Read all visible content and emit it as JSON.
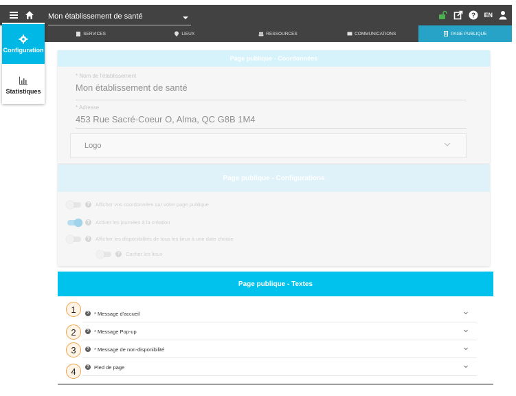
{
  "topbar": {
    "establishment": "Mon établissement de santé",
    "lang": "EN"
  },
  "tabs": [
    {
      "label": "SERVICES",
      "icon": "building-icon"
    },
    {
      "label": "LIEUX",
      "icon": "location-pin-icon"
    },
    {
      "label": "RESSOURCES",
      "icon": "users-icon"
    },
    {
      "label": "COMMUNICATIONS",
      "icon": "envelope-icon"
    },
    {
      "label": "PAGE PUBLIQUE",
      "icon": "document-icon",
      "active": true
    }
  ],
  "sidebar": {
    "items": [
      {
        "label": "Configuration",
        "icon": "gear-icon",
        "active": true
      },
      {
        "label": "Statistiques",
        "icon": "bar-chart-icon"
      }
    ]
  },
  "coords_panel": {
    "title": "Page publique - Coordonnées",
    "name_label": "* Nom de l'établissement",
    "name_value": "Mon établissement de santé",
    "address_label": "* Adresse",
    "address_value": "453 Rue Sacré-Coeur O, Alma, QC G8B 1M4",
    "logo_label": "Logo"
  },
  "config_panel": {
    "title": "Page publique - Configurations",
    "toggles": [
      {
        "label": "Afficher vos coordonnées sur votre page publique",
        "on": false
      },
      {
        "label": "Activer les journées à la création",
        "on": true
      },
      {
        "label": "Afficher les disponibilités de tous les lieux à une date choisie",
        "on": false
      },
      {
        "label": "Cacher les lieux",
        "on": false
      }
    ]
  },
  "texts_panel": {
    "title": "Page publique - Textes",
    "items": [
      {
        "label": "* Message d'accueil",
        "marker": "1"
      },
      {
        "label": "* Message Pop-up",
        "marker": "2"
      },
      {
        "label": "* Message de non-disponibilité",
        "marker": "3"
      },
      {
        "label": "Pied de page",
        "marker": "4"
      }
    ]
  },
  "colors": {
    "topbar": "#424242",
    "accent": "#00c2ec",
    "active_tab": "#26a3c6",
    "unlock_icon": "#4caf50",
    "marker_border": "#f0a54b"
  }
}
